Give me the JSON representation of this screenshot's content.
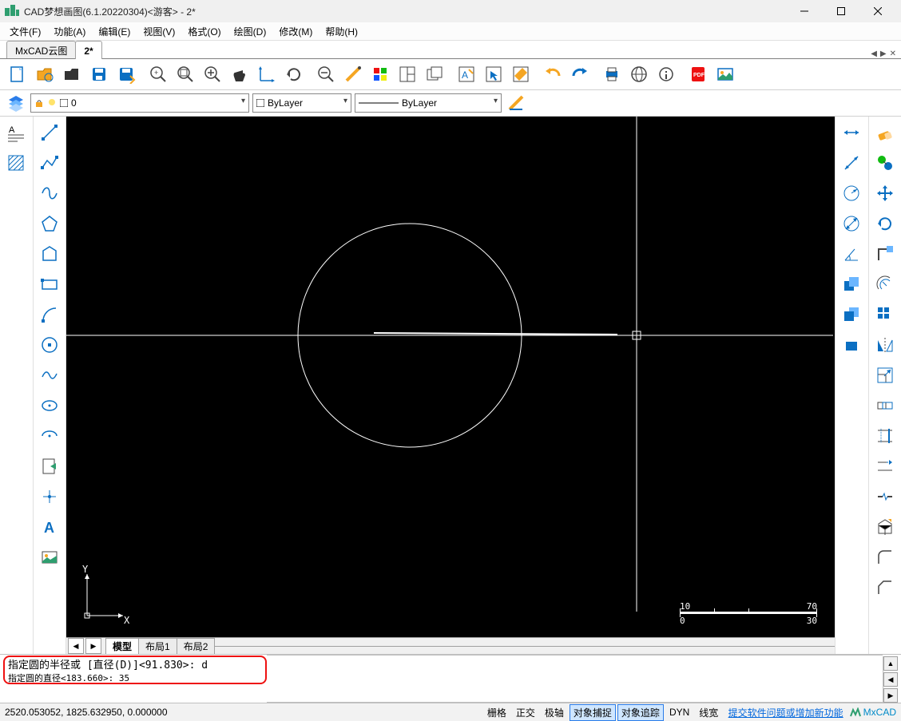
{
  "title": "CAD梦想画图(6.1.20220304)<游客> - 2*",
  "menu": {
    "file": "文件(F)",
    "func": "功能(A)",
    "edit": "编辑(E)",
    "view": "视图(V)",
    "format": "格式(O)",
    "draw": "绘图(D)",
    "modify": "修改(M)",
    "help": "帮助(H)"
  },
  "tabs": {
    "cloud": "MxCAD云图",
    "active": "2*"
  },
  "layer": {
    "current": "0",
    "color_label": "ByLayer",
    "linetype_label": "ByLayer"
  },
  "scale": {
    "t0": "10",
    "t1": "70",
    "b0": "0",
    "b1": "30"
  },
  "ucs": {
    "x": "X",
    "y": "Y"
  },
  "model_tabs": {
    "model": "模型",
    "l1": "布局1",
    "l2": "布局2"
  },
  "cmd": {
    "line1": "指定圆的半径或 [直径(D)]<91.830>: d",
    "line2": "指定圆的直径<183.660>: 35"
  },
  "status": {
    "coords": "2520.053052, 1825.632950, 0.000000",
    "grid": "栅格",
    "ortho": "正交",
    "polar": "极轴",
    "osnap": "对象捕捉",
    "otrack": "对象追踪",
    "dyn": "DYN",
    "lwt": "线宽",
    "link": "提交软件问题或增加新功能",
    "brand": "MxCAD"
  }
}
